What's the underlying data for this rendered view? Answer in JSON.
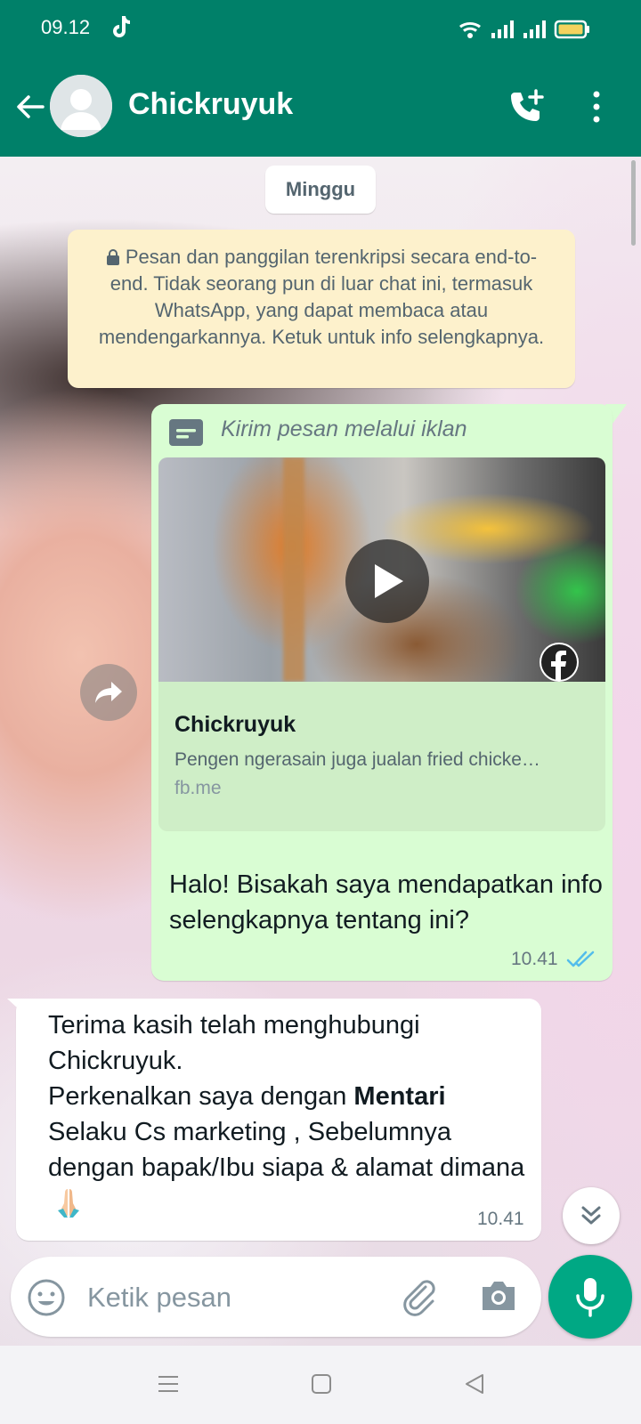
{
  "status_bar": {
    "time": "09.12"
  },
  "header": {
    "contact_name": "Chickruyuk"
  },
  "chat": {
    "date_chip": "Minggu",
    "encryption_notice": "Pesan dan panggilan terenkripsi secara end-to-end. Tidak seorang pun di luar chat ini, termasuk WhatsApp, yang dapat membaca atau mendengarkannya. Ketuk untuk info selengkapnya.",
    "outgoing": {
      "ad_label": "Kirim pesan melalui iklan",
      "link_title": "Chickruyuk",
      "link_description": "Pengen ngerasain juga jualan fried chicke…",
      "link_url": "fb.me",
      "text": "Halo! Bisakah saya mendapatkan info selengkapnya tentang ini?",
      "time": "10.41"
    },
    "incoming": {
      "line1": "Terima kasih telah menghubungi Chickruyuk.",
      "line2_prefix": "Perkenalkan saya dengan ",
      "line2_bold": "Mentari",
      "line3": "Selaku Cs marketing , Sebelumnya dengan bapak/Ibu siapa & alamat dimana",
      "time": "10.41"
    }
  },
  "composer": {
    "placeholder": "Ketik pesan"
  },
  "colors": {
    "header": "#008069",
    "accent": "#00a884",
    "outgoing_bubble": "#d9fdd3",
    "incoming_bubble": "#ffffff",
    "read_ticks": "#53bdeb"
  }
}
